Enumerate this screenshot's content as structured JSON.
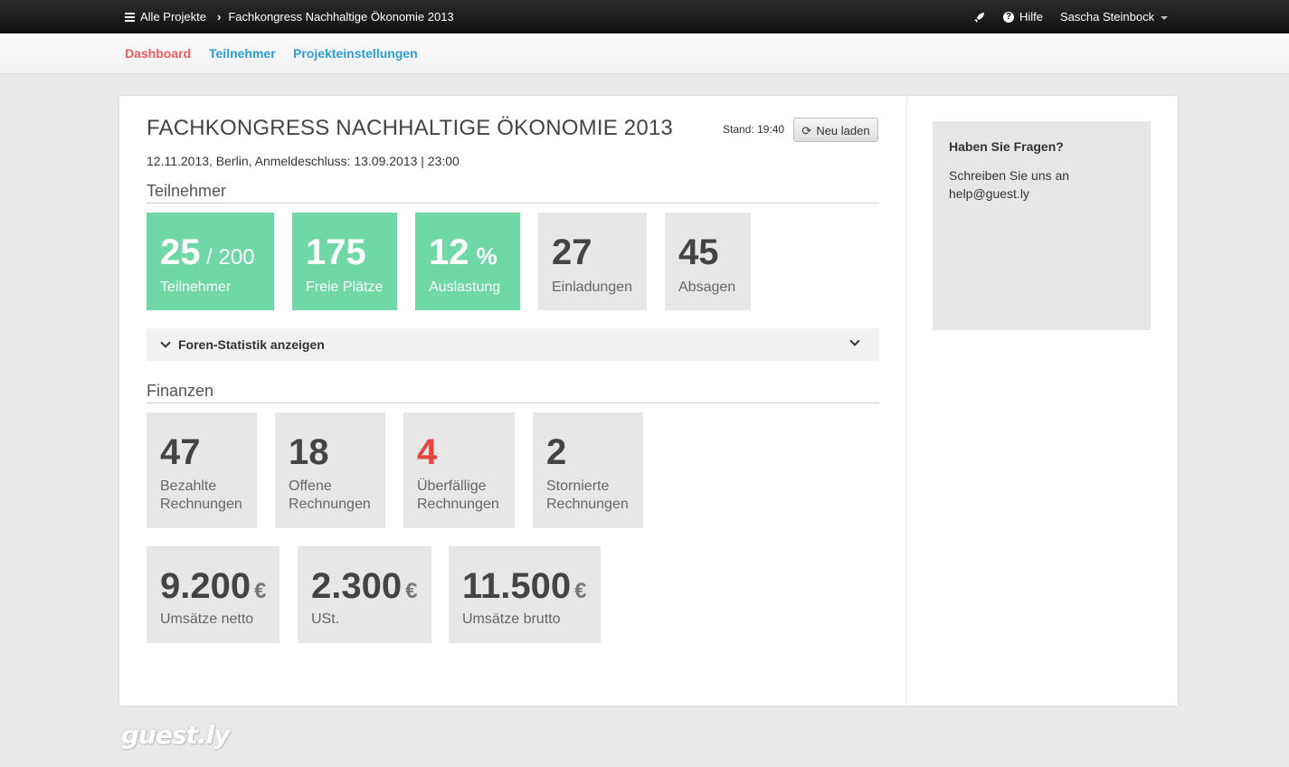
{
  "topbar": {
    "all_projects": "Alle Projekte",
    "project_title": "Fachkongress Nachhaltige Ökonomie 2013",
    "help": "Hilfe",
    "user": "Sascha Steinbock"
  },
  "subnav": {
    "items": [
      "Dashboard",
      "Teilnehmer",
      "Projekteinstellungen"
    ],
    "active": "Dashboard"
  },
  "header": {
    "title": "FACHKONGRESS NACHHALTIGE ÖKONOMIE 2013",
    "meta": "12.11.2013, Berlin, Anmeldeschluss: 13.09.2013 | 23:00",
    "stand": "Stand: 19:40",
    "reload_label": "Neu laden"
  },
  "teilnehmer": {
    "heading": "Teilnehmer",
    "tiles": [
      {
        "value": "25",
        "suffix": "/ 200",
        "label": "Teilnehmer"
      },
      {
        "value": "175",
        "label": "Freie Plätze"
      },
      {
        "value": "12",
        "suffix": "%",
        "label": "Auslastung"
      },
      {
        "value": "27",
        "label": "Einladungen"
      },
      {
        "value": "45",
        "label": "Absagen"
      }
    ],
    "forum_toggle": "Foren-Statistik anzeigen"
  },
  "finanzen": {
    "heading": "Finanzen",
    "invoices": [
      {
        "value": "47",
        "label1": "Bezahlte",
        "label2": "Rechnungen"
      },
      {
        "value": "18",
        "label1": "Offene",
        "label2": "Rechnungen"
      },
      {
        "value": "4",
        "label1": "Überfällige",
        "label2": "Rechnungen"
      },
      {
        "value": "2",
        "label1": "Stornierte",
        "label2": "Rechnungen"
      }
    ],
    "revenue": [
      {
        "value": "9.200",
        "currency": "€",
        "label": "Umsätze netto"
      },
      {
        "value": "2.300",
        "currency": "€",
        "label": "USt."
      },
      {
        "value": "11.500",
        "currency": "€",
        "label": "Umsätze brutto"
      }
    ]
  },
  "sidebar": {
    "heading": "Haben Sie Fragen?",
    "text": "Schreiben Sie uns an help@guest.ly"
  },
  "footer": {
    "logo": "guest.ly"
  },
  "colors": {
    "accent_green": "#6fd8a6",
    "active_red": "#f0595f",
    "link_blue": "#2a9fd6",
    "overdue_red": "#e5453f"
  }
}
